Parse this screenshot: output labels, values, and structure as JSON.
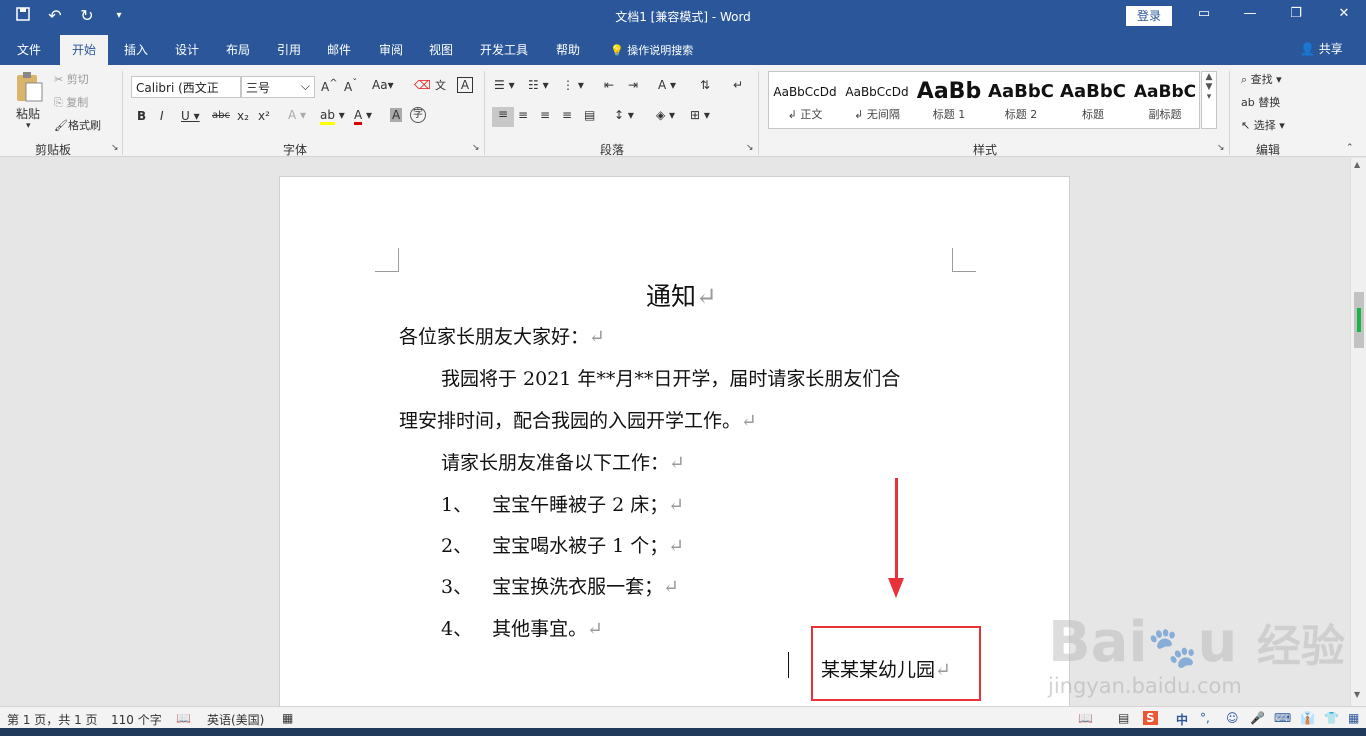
{
  "titlebar": {
    "title": "文档1 [兼容模式] - Word",
    "login": "登录",
    "save_icon": "save-icon",
    "undo_icon": "undo-icon",
    "redo_icon": "redo-icon"
  },
  "tabs": {
    "items": [
      "文件",
      "开始",
      "插入",
      "设计",
      "布局",
      "引用",
      "邮件",
      "审阅",
      "视图",
      "开发工具",
      "帮助"
    ],
    "active": "开始",
    "tellme": "操作说明搜索",
    "share": "共享"
  },
  "ribbon": {
    "clipboard": {
      "paste": "粘贴",
      "cut": "剪切",
      "copy": "复制",
      "format_painter": "格式刷",
      "label": "剪贴板"
    },
    "font": {
      "name": "Calibri (西文正",
      "size": "三号",
      "label": "字体"
    },
    "paragraph": {
      "label": "段落"
    },
    "styles": {
      "label": "样式",
      "items": [
        {
          "preview": "AaBbCcDd",
          "name": "↲ 正文"
        },
        {
          "preview": "AaBbCcDd",
          "name": "↲ 无间隔"
        },
        {
          "preview": "AaBb",
          "name": "标题 1"
        },
        {
          "preview": "AaBbC",
          "name": "标题 2"
        },
        {
          "preview": "AaBbC",
          "name": "标题"
        },
        {
          "preview": "AaBbC",
          "name": "副标题"
        }
      ]
    },
    "editing": {
      "find": "查找",
      "replace": "替换",
      "select": "选择",
      "label": "编辑"
    }
  },
  "document": {
    "title": "通知",
    "greeting": "各位家长朋友大家好：",
    "para1_line1": "我园将于 2021 年**月**日开学，届时请家长朋友们合",
    "para1_line2": "理安排时间，配合我园的入园开学工作。",
    "para2": "请家长朋友准备以下工作：",
    "list": [
      {
        "num": "1、",
        "text": "宝宝午睡被子 2 床；"
      },
      {
        "num": "2、",
        "text": "宝宝喝水被子 1 个；"
      },
      {
        "num": "3、",
        "text": "宝宝换洗衣服一套；"
      },
      {
        "num": "4、",
        "text": "其他事宜。"
      }
    ],
    "signature": "某某某幼儿园",
    "para_mark": "↵"
  },
  "statusbar": {
    "page": "第 1 页，共 1 页",
    "words": "110 个字",
    "language": "英语(美国)"
  },
  "watermark": {
    "text": "Bai",
    "text2": "经验",
    "url": "jingyan.baidu.com"
  },
  "colors": {
    "accent": "#2b579a",
    "annotation": "#e8323a"
  }
}
